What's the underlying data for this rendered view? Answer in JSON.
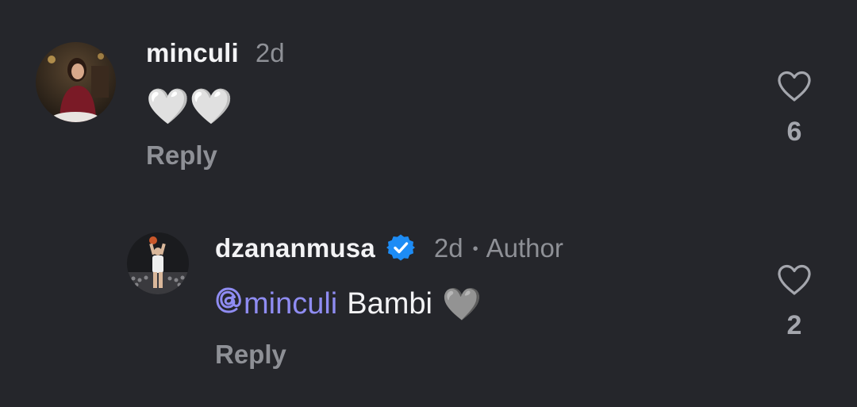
{
  "comments": [
    {
      "username": "minculi",
      "time": "2d",
      "body_emoji": "🤍🤍",
      "reply_label": "Reply",
      "like_count": "6"
    },
    {
      "username": "dzananmusa",
      "time": "2d",
      "separator": "•",
      "author_tag": "Author",
      "mention": "minculi",
      "body_text": "Bambi",
      "body_emoji": "🩶",
      "reply_label": "Reply",
      "like_count": "2"
    }
  ],
  "icons": {
    "like": "heart-outline-icon",
    "verified": "verified-badge-icon",
    "mention": "threads-at-icon"
  },
  "colors": {
    "background": "#25262b",
    "primary_text": "#f3f3f5",
    "secondary_text": "#8e9096",
    "mention": "#8f8cf2",
    "verified": "#1d8cf5"
  }
}
